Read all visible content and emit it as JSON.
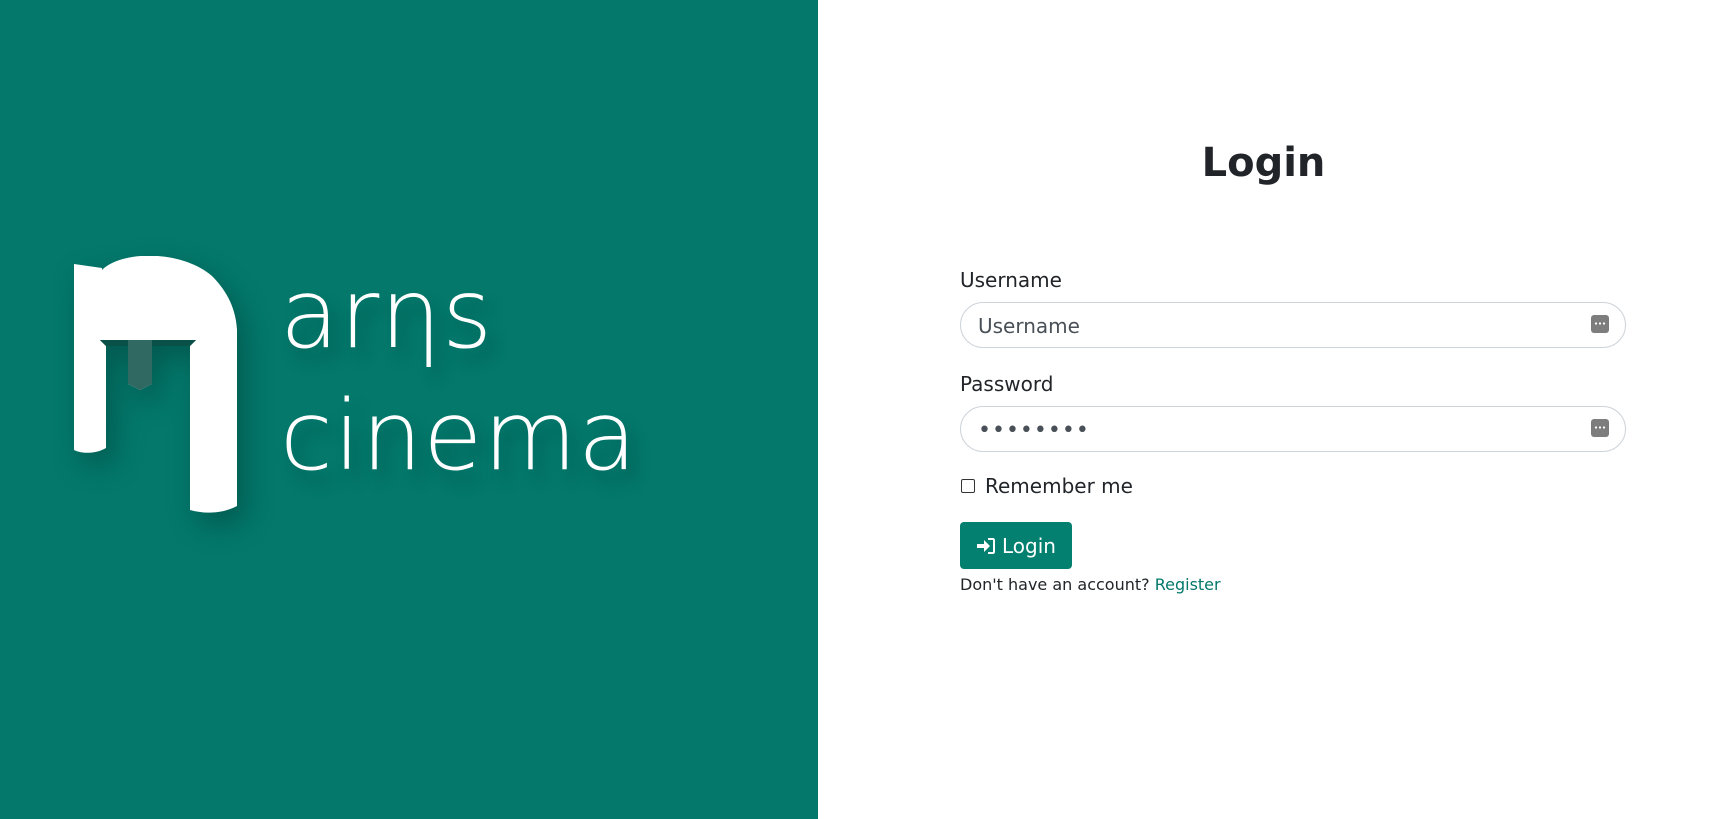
{
  "brand": {
    "logo_line1": "arηs",
    "logo_line2": "cinema",
    "background_color": "#03786b"
  },
  "login": {
    "title": "Login",
    "username_label": "Username",
    "username_placeholder": "Username",
    "username_value": "",
    "password_label": "Password",
    "password_value": "••••••••",
    "field_icon": "password-manager-icon",
    "remember_label": "Remember me",
    "remember_checked": false,
    "submit_label": "Login",
    "submit_icon": "sign-in-icon",
    "register_prompt": "Don't have an account?",
    "register_link": "Register",
    "accent_color": "#03806f"
  }
}
